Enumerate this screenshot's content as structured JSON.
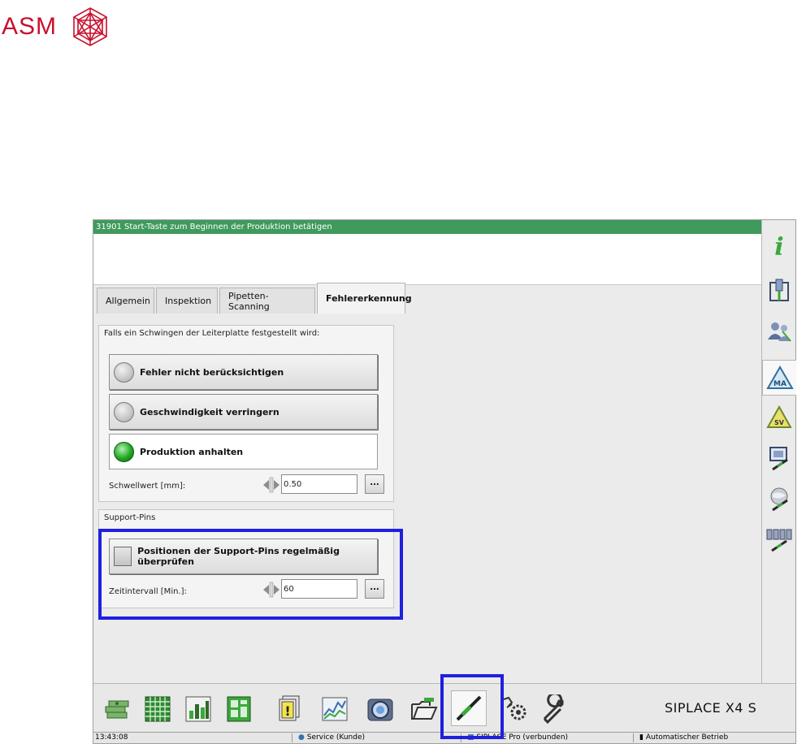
{
  "brand_logo": {
    "text": "ASM",
    "color": "#c8102e"
  },
  "status_message": "31901 Start-Taste zum Beginnen der Produktion betätigen",
  "status_color": "#3f9a5c",
  "tabs": [
    {
      "label": "Allgemein",
      "active": false
    },
    {
      "label": "Inspektion",
      "active": false
    },
    {
      "label": "Pipetten-Scanning",
      "active": false
    },
    {
      "label": "Fehlererkennung",
      "active": true
    }
  ],
  "swing_group": {
    "title": "Falls ein Schwingen der Leiterplatte festgestellt wird:",
    "options": [
      {
        "label": "Fehler nicht berücksichtigen",
        "selected": false
      },
      {
        "label": "Geschwindigkeit verringern",
        "selected": false
      },
      {
        "label": "Produktion anhalten",
        "selected": true
      }
    ],
    "threshold_label": "Schwellwert [mm]:",
    "threshold_value": "0.50",
    "dots_label": "..."
  },
  "support_group": {
    "title": "Support-Pins",
    "checkbox_label": "Positionen der Support-Pins regelmäßig überprüfen",
    "checked": false,
    "interval_label": "Zeitintervall [Min.]:",
    "interval_value": "60",
    "dots_label": "..."
  },
  "sidebar_icons": [
    "info-icon",
    "machine-pipette-icon",
    "users-icon",
    "ma-triangle-icon",
    "sv-triangle-icon",
    "monitor-screwdriver-icon",
    "globe-screwdriver-icon",
    "feeders-screwdriver-icon"
  ],
  "toolbar_icons": [
    "money-stack-icon",
    "grid-table-icon",
    "bar-chart-icon",
    "board-layout-icon",
    "warning-docs-icon",
    "trend-chart-icon",
    "camera-icon",
    "open-folder-icon",
    "screwdriver-icon",
    "gears-icon",
    "wrench-icon"
  ],
  "machine_name": "SIPLACE X4 S",
  "statusbar": {
    "time": "13:43:08",
    "user": "Service (Kunde)",
    "connection": "SIPLACE Pro (verbunden)",
    "mode": "Automatischer Betrieb"
  },
  "highlight_color": "#1f1fe0"
}
